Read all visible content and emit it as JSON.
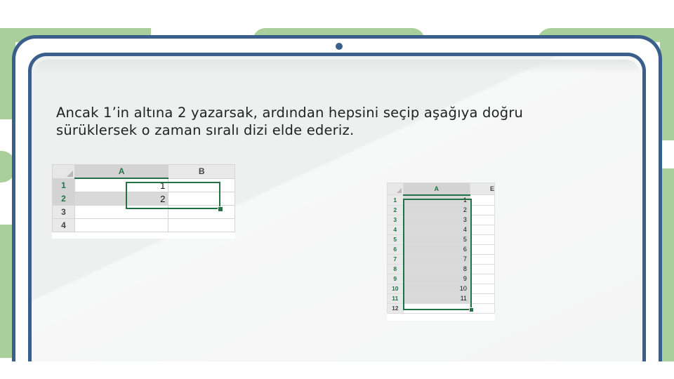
{
  "slide": {
    "text_lines": [
      "Ancak 1’in altına 2 yazarsak, ardından hepsini seçip aşağıya doğru",
      "sürüklersek o zaman sıralı dizi elde ederiz."
    ]
  },
  "sheet_small": {
    "columns": [
      "A",
      "B"
    ],
    "rows": [
      {
        "num": "1",
        "a": "1",
        "b": ""
      },
      {
        "num": "2",
        "a": "2",
        "b": ""
      },
      {
        "num": "3",
        "a": "",
        "b": ""
      },
      {
        "num": "4",
        "a": "",
        "b": ""
      }
    ]
  },
  "sheet_large": {
    "columns": [
      "A",
      "E"
    ],
    "rows": [
      {
        "num": "1",
        "a": "1"
      },
      {
        "num": "2",
        "a": "2"
      },
      {
        "num": "3",
        "a": "3"
      },
      {
        "num": "4",
        "a": "4"
      },
      {
        "num": "5",
        "a": "5"
      },
      {
        "num": "6",
        "a": "6"
      },
      {
        "num": "7",
        "a": "7"
      },
      {
        "num": "8",
        "a": "8"
      },
      {
        "num": "9",
        "a": "9"
      },
      {
        "num": "10",
        "a": "10"
      },
      {
        "num": "11",
        "a": "11"
      },
      {
        "num": "12",
        "a": ""
      }
    ]
  },
  "colors": {
    "frame": "#3a5f8c",
    "background_accent": "#a9d09a",
    "excel_green": "#217346"
  }
}
